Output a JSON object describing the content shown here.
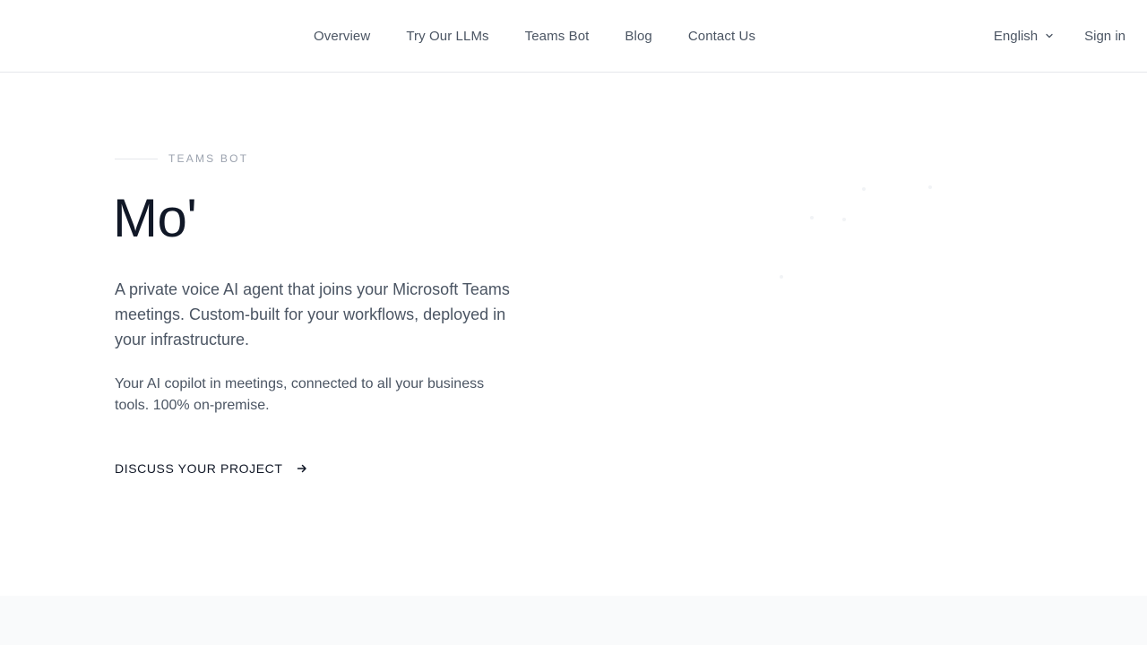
{
  "nav": {
    "items": [
      {
        "label": "Overview"
      },
      {
        "label": "Try Our LLMs"
      },
      {
        "label": "Teams Bot"
      },
      {
        "label": "Blog"
      },
      {
        "label": "Contact Us"
      }
    ],
    "language": "English",
    "language_icon": "chevron-down-icon",
    "signin": "Sign in"
  },
  "hero": {
    "eyebrow": "TEAMS BOT",
    "title": "Mo'",
    "lead": "A private voice AI agent that joins your Microsoft Teams meetings. Custom-built for your workflows, deployed in your infrastructure.",
    "sub": "Your AI copilot in meetings, connected to all your business tools. 100% on-premise.",
    "cta": "DISCUSS YOUR PROJECT",
    "cta_icon": "arrow-right-icon"
  },
  "colors": {
    "text_primary": "#111827",
    "text_secondary": "#4b5563",
    "text_muted": "#9ca3af",
    "border": "#e5e7eb",
    "band": "#f9fafb"
  }
}
